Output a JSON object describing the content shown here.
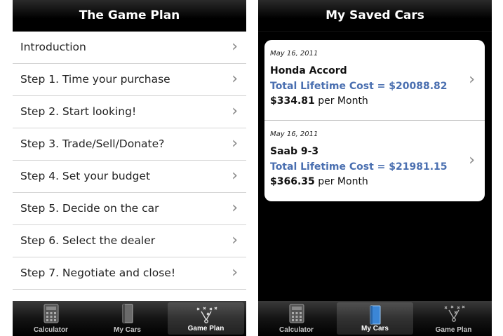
{
  "left": {
    "title": "The Game Plan",
    "items": [
      {
        "label": "Introduction"
      },
      {
        "label": "Step 1. Time your purchase"
      },
      {
        "label": "Step 2. Start looking!"
      },
      {
        "label": "Step 3. Trade/Sell/Donate?"
      },
      {
        "label": "Step 4. Set your budget"
      },
      {
        "label": "Step 5. Decide on the car"
      },
      {
        "label": "Step 6. Select the dealer"
      },
      {
        "label": "Step 7. Negotiate and close!"
      }
    ],
    "tabs": [
      "Calculator",
      "My Cars",
      "Game Plan"
    ],
    "active_tab": "Game Plan"
  },
  "right": {
    "title": "My Saved Cars",
    "cars": [
      {
        "date": "May 16, 2011",
        "name": "Honda Accord",
        "cost_label": "Total Lifetime Cost = ",
        "cost_value": "$20088.82",
        "monthly_value": "$334.81",
        "monthly_unit": "per Month"
      },
      {
        "date": "May 16, 2011",
        "name": "Saab 9-3",
        "cost_label": "Total Lifetime Cost = ",
        "cost_value": "$21981.15",
        "monthly_value": "$366.35",
        "monthly_unit": "per Month"
      }
    ],
    "tabs": [
      "Calculator",
      "My Cars",
      "Game Plan"
    ],
    "active_tab": "My Cars"
  },
  "icons": {
    "chevron": "chevron-right-icon",
    "calculator": "calculator-icon",
    "my_cars": "book-icon",
    "game_plan": "play-diagram-icon"
  },
  "colors": {
    "nav_bg": "#000000",
    "cost_text": "#4a6fb0",
    "list_bg": "#ffffff"
  }
}
